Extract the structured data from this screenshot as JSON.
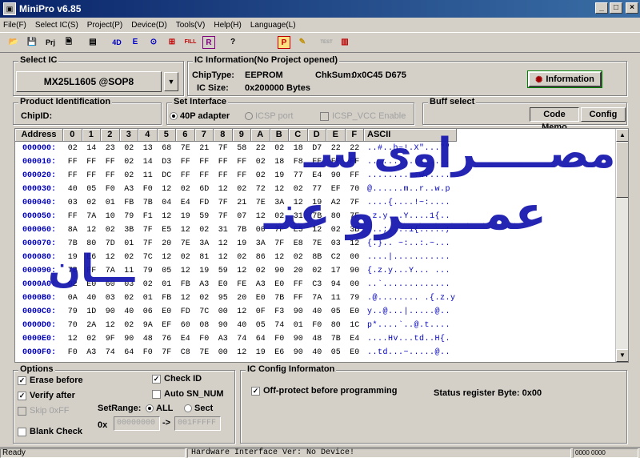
{
  "window": {
    "title": "MiniPro v6.85"
  },
  "menu": [
    "File(F)",
    "Select IC(S)",
    "Project(P)",
    "Device(D)",
    "Tools(V)",
    "Help(H)",
    "Language(L)"
  ],
  "toolbar": {
    "icons": [
      "open-icon",
      "save-icon",
      "project-icon",
      "save-project-icon",
      "read-icon",
      "verify-icon",
      "blank-check-icon",
      "erase-icon",
      "program-icon",
      "auto-icon",
      "help-icon",
      "settings-icon",
      "edit-icon",
      "test-icon",
      "chip-icon"
    ],
    "labels": {
      "read": "4D",
      "verify": "E",
      "fill": "FILL",
      "test": "TEST",
      "p": "P",
      "r": "R",
      "help": "?"
    }
  },
  "select_ic": {
    "label": "Select IC",
    "value": "MX25L1605 @SOP8"
  },
  "ic_info": {
    "label": "IC Information(No Project opened)",
    "chip_type_label": "ChipType:",
    "chip_type": "EEPROM",
    "chksum_label": "ChkSum:",
    "chksum": "0x0C45 D675",
    "ic_size_label": "IC Size:",
    "ic_size": "0x200000 Bytes",
    "info_button": "Information"
  },
  "product_id": {
    "label": "Product Identification",
    "chip_id_label": "ChipID:"
  },
  "interface": {
    "label": "Set Interface",
    "opt1": "40P adapter",
    "opt2": "ICSP port",
    "opt3": "ICSP_VCC Enable"
  },
  "buff": {
    "label": "Buff select",
    "code_memo": "Code Memo",
    "config": "Config"
  },
  "hex": {
    "headers": [
      "Address",
      "0",
      "1",
      "2",
      "3",
      "4",
      "5",
      "6",
      "7",
      "8",
      "9",
      "A",
      "B",
      "C",
      "D",
      "E",
      "F",
      "ASCII"
    ],
    "rows": [
      {
        "addr": "000000:",
        "bytes": [
          "02",
          "14",
          "23",
          "02",
          "13",
          "68",
          "7E",
          "21",
          "7F",
          "58",
          "22",
          "02",
          "18",
          "D7",
          "22",
          "22"
        ],
        "ascii": "..#..h~!.X\"...\"\""
      },
      {
        "addr": "000010:",
        "bytes": [
          "FF",
          "FF",
          "FF",
          "02",
          "14",
          "D3",
          "FF",
          "FF",
          "FF",
          "FF",
          "02",
          "18",
          "F8",
          "FF",
          "FF",
          "FF"
        ],
        "ascii": "................"
      },
      {
        "addr": "000020:",
        "bytes": [
          "FF",
          "FF",
          "FF",
          "02",
          "11",
          "DC",
          "FF",
          "FF",
          "FF",
          "FF",
          "02",
          "19",
          "77",
          "E4",
          "90",
          "FF"
        ],
        "ascii": "..........w....."
      },
      {
        "addr": "000030:",
        "bytes": [
          "40",
          "05",
          "F0",
          "A3",
          "F0",
          "12",
          "02",
          "6D",
          "12",
          "02",
          "72",
          "12",
          "02",
          "77",
          "EF",
          "70"
        ],
        "ascii": "@......m..r..w.p"
      },
      {
        "addr": "000040:",
        "bytes": [
          "03",
          "02",
          "01",
          "FB",
          "7B",
          "04",
          "E4",
          "FD",
          "7F",
          "21",
          "7E",
          "3A",
          "12",
          "19",
          "A2",
          "7F"
        ],
        "ascii": "....{....!~:...."
      },
      {
        "addr": "000050:",
        "bytes": [
          "FF",
          "7A",
          "10",
          "79",
          "F1",
          "12",
          "19",
          "59",
          "7F",
          "07",
          "12",
          "02",
          "31",
          "7B",
          "80",
          "7F"
        ],
        "ascii": ".z.y...Y....1{.."
      },
      {
        "addr": "000060:",
        "bytes": [
          "8A",
          "12",
          "02",
          "3B",
          "7F",
          "E5",
          "12",
          "02",
          "31",
          "7B",
          "00",
          "7F",
          "E5",
          "12",
          "02",
          "3B"
        ],
        "ascii": "...;....1{.....;"
      },
      {
        "addr": "000070:",
        "bytes": [
          "7B",
          "80",
          "7D",
          "01",
          "7F",
          "20",
          "7E",
          "3A",
          "12",
          "19",
          "3A",
          "7F",
          "E8",
          "7E",
          "03",
          "12"
        ],
        "ascii": "{.}.. ~:..:.~..."
      },
      {
        "addr": "000080:",
        "bytes": [
          "19",
          "E6",
          "12",
          "02",
          "7C",
          "12",
          "02",
          "81",
          "12",
          "02",
          "86",
          "12",
          "02",
          "8B",
          "C2",
          "00"
        ],
        "ascii": "....|..........."
      },
      {
        "addr": "000090:",
        "bytes": [
          "7B",
          "FF",
          "7A",
          "11",
          "79",
          "05",
          "12",
          "19",
          "59",
          "12",
          "02",
          "90",
          "20",
          "02",
          "17",
          "90"
        ],
        "ascii": "{.z.y...Y... ..."
      },
      {
        "addr": "0000A0:",
        "bytes": [
          "02",
          "E0",
          "60",
          "03",
          "02",
          "01",
          "FB",
          "A3",
          "E0",
          "FE",
          "A3",
          "E0",
          "FF",
          "C3",
          "94",
          "00"
        ],
        "ascii": "..`............."
      },
      {
        "addr": "0000B0:",
        "bytes": [
          "0A",
          "40",
          "03",
          "02",
          "01",
          "FB",
          "12",
          "02",
          "95",
          "20",
          "E0",
          "7B",
          "FF",
          "7A",
          "11",
          "79"
        ],
        "ascii": ".@........ .{.z.y"
      },
      {
        "addr": "0000C0:",
        "bytes": [
          "79",
          "1D",
          "90",
          "40",
          "06",
          "E0",
          "FD",
          "7C",
          "00",
          "12",
          "0F",
          "F3",
          "90",
          "40",
          "05",
          "E0"
        ],
        "ascii": "y..@...|.....@.."
      },
      {
        "addr": "0000D0:",
        "bytes": [
          "70",
          "2A",
          "12",
          "02",
          "9A",
          "EF",
          "60",
          "08",
          "90",
          "40",
          "05",
          "74",
          "01",
          "F0",
          "80",
          "1C"
        ],
        "ascii": "p*....`..@.t...."
      },
      {
        "addr": "0000E0:",
        "bytes": [
          "12",
          "02",
          "9F",
          "90",
          "48",
          "76",
          "E4",
          "F0",
          "A3",
          "74",
          "64",
          "F0",
          "90",
          "48",
          "7B",
          "E4"
        ],
        "ascii": "....Hv...td..H{."
      },
      {
        "addr": "0000F0:",
        "bytes": [
          "F0",
          "A3",
          "74",
          "64",
          "F0",
          "7F",
          "C8",
          "7E",
          "00",
          "12",
          "19",
          "E6",
          "90",
          "40",
          "05",
          "E0"
        ],
        "ascii": "..td...~.....@.."
      }
    ]
  },
  "options": {
    "label": "Options",
    "erase_before": "Erase before",
    "verify_after": "Verify after",
    "skip_0xff": "Skip 0xFF",
    "blank_check": "Blank Check",
    "check_id": "Check ID",
    "auto_sn": "Auto SN_NUM",
    "set_range": "SetRange:",
    "all": "ALL",
    "sect": "Sect",
    "ox": "0x",
    "from": "00000000",
    "arrow": "->",
    "to": "001FFFFF"
  },
  "ic_config": {
    "label": "IC Config Informaton",
    "off_protect": "Off-protect before programming",
    "status_reg": "Status register Byte: 0x00"
  },
  "status": {
    "ready": "Ready",
    "hw": "Hardware Interface Ver: No Device!",
    "code": "0000 0000"
  },
  "watermark": {
    "line1": "مصـــــراوى سـ",
    "line2": "عمـــــرو عنـ",
    "line3": "ـــان"
  }
}
